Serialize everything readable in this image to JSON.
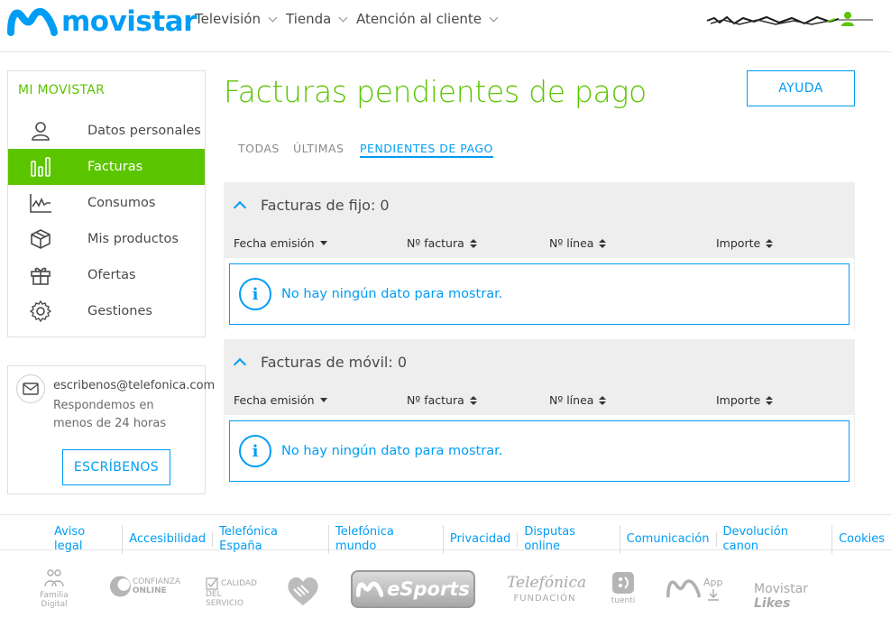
{
  "header": {
    "logo_text": "movistar",
    "nav": [
      {
        "label": "Televisión"
      },
      {
        "label": "Tienda"
      },
      {
        "label": "Atención al cliente"
      }
    ]
  },
  "sidebar": {
    "title": "MI MOVISTAR",
    "items": [
      {
        "label": "Datos personales",
        "icon": "user-icon"
      },
      {
        "label": "Facturas",
        "icon": "bars-icon",
        "active": true
      },
      {
        "label": "Consumos",
        "icon": "chart-icon"
      },
      {
        "label": "Mis productos",
        "icon": "box-icon"
      },
      {
        "label": "Ofertas",
        "icon": "gift-icon"
      },
      {
        "label": "Gestiones",
        "icon": "gear-icon"
      }
    ]
  },
  "contact": {
    "email": "escribenos@telefonica.com",
    "note": "Respondemos en menos de 24 horas",
    "button": "ESCRÍBENOS"
  },
  "main": {
    "title": "Facturas pendientes de pago",
    "help_button": "AYUDA",
    "tabs": [
      {
        "label": "TODAS"
      },
      {
        "label": "ÚLTIMAS"
      },
      {
        "label": "PENDIENTES DE PAGO",
        "active": true
      }
    ],
    "panels": [
      {
        "title": "Facturas de fijo: 0",
        "columns": [
          "Fecha emisión",
          "Nº factura",
          "Nº línea",
          "Importe"
        ],
        "empty_message": "No hay ningún dato para mostrar."
      },
      {
        "title": "Facturas de móvil: 0",
        "columns": [
          "Fecha emisión",
          "Nº factura",
          "Nº línea",
          "Importe"
        ],
        "empty_message": "No hay ningún dato para mostrar."
      }
    ]
  },
  "footer": {
    "links": [
      "Aviso legal",
      "Accesibilidad",
      "Telefónica España",
      "Telefónica mundo",
      "Privacidad",
      "Disputas online",
      "Comunicación",
      "Devolución canon",
      "Cookies"
    ],
    "brands": {
      "familia": "Familia Digital",
      "confianza_1": "CONFIANZA",
      "confianza_2": "ONLINE",
      "calidad_1": "CALIDAD",
      "calidad_2": "DEL SERVICIO",
      "esports": "eSports",
      "telefonica": "Telefónica",
      "fundacion": "FUNDACIÓN",
      "tuenti": "tuenti",
      "app": "App",
      "likes_a": "Movistar",
      "likes_b": "Likes"
    }
  },
  "colors": {
    "brand_blue": "#019df4",
    "brand_green": "#5bc500"
  }
}
